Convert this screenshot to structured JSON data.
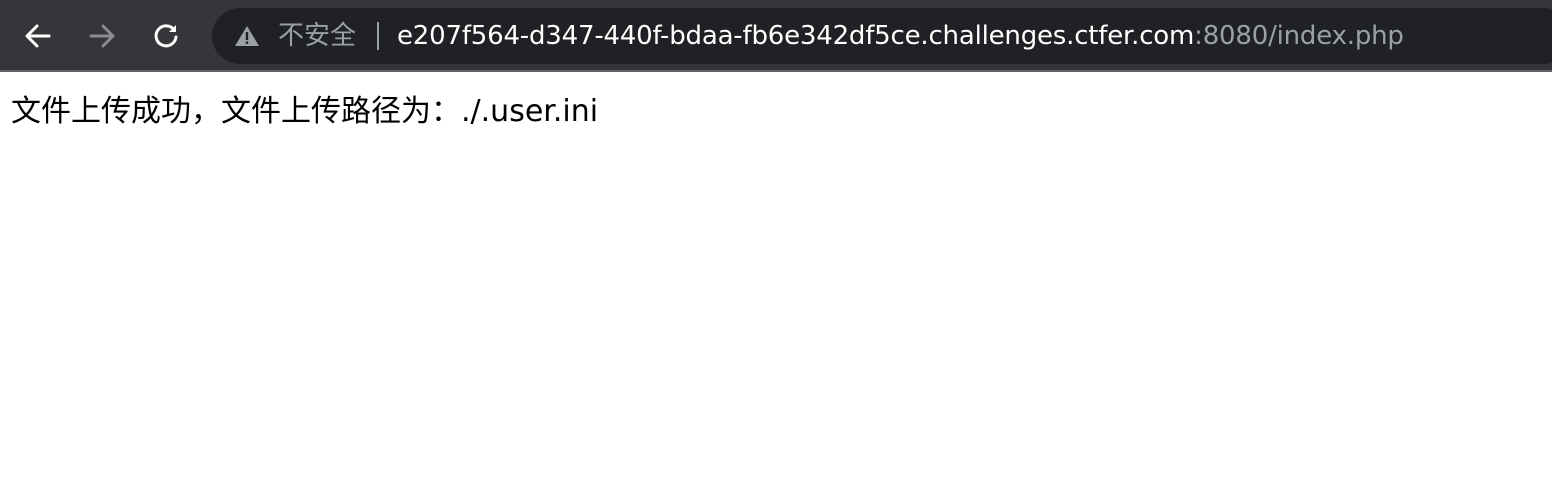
{
  "browser": {
    "nav": {
      "back_icon": "arrow-left-icon",
      "forward_icon": "arrow-right-icon",
      "reload_icon": "reload-icon"
    },
    "omnibox": {
      "security_icon": "warning-triangle-icon",
      "security_label": "不安全",
      "url_host": "e207f564-d347-440f-bdaa-fb6e342df5ce.challenges.ctfer.com",
      "url_rest": ":8080/index.php"
    },
    "colors": {
      "toolbar": "#35363a",
      "omnibox": "#202124",
      "text_primary": "#ffffff",
      "text_muted": "#9aa0a6"
    }
  },
  "page": {
    "message": "文件上传成功，文件上传路径为：./.user.ini"
  }
}
